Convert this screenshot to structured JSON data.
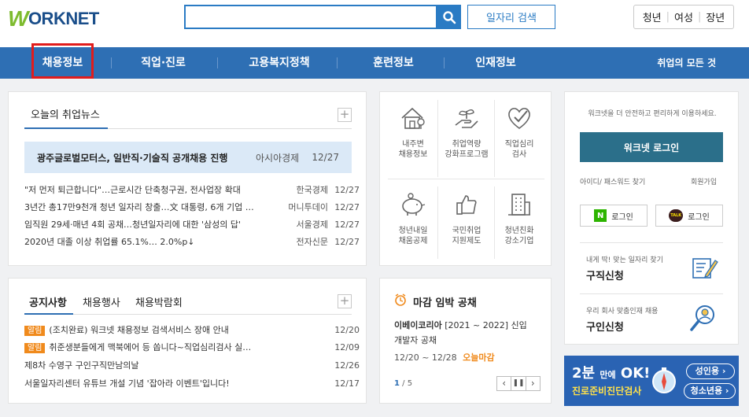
{
  "header": {
    "logo_w": "W",
    "logo_rest": "ORKNET",
    "search": {
      "value": "",
      "placeholder": ""
    },
    "job_search_label": "일자리 검색",
    "target_groups": [
      "청년",
      "여성",
      "장년"
    ]
  },
  "nav": {
    "items": [
      "채용정보",
      "직업·진로",
      "고용복지정책",
      "훈련정보",
      "인재정보"
    ],
    "right_label": "취업의 모든 것"
  },
  "news": {
    "tab_title": "오늘의 취업뉴스",
    "featured": {
      "title": "광주글로벌모터스, 일반직·기술직 공개채용 진행",
      "source": "아시아경제",
      "date": "12/27"
    },
    "items": [
      {
        "title": "\"저 먼저 퇴근합니다\"…근로시간 단축청구권, 전사업장 확대",
        "source": "한국경제",
        "date": "12/27"
      },
      {
        "title": "3년간 총17만9천개 청년 일자리 창출…文 대통령, 6개 기업 …",
        "source": "머니투데이",
        "date": "12/27"
      },
      {
        "title": "임직원 29세·매년 4회 공채…청년일자리에 대한 '삼성의 답'",
        "source": "서울경제",
        "date": "12/27"
      },
      {
        "title": "2020년 대졸 이상 취업률 65.1%… 2.0%p↓",
        "source": "전자신문",
        "date": "12/27"
      }
    ]
  },
  "quick": {
    "items": [
      {
        "line1": "내주변",
        "line2": "채용정보",
        "icon": "house-pin-icon"
      },
      {
        "line1": "취업역량",
        "line2": "강화프로그램",
        "icon": "hand-sprout-icon"
      },
      {
        "line1": "직업심리",
        "line2": "검사",
        "icon": "heart-check-icon"
      },
      {
        "line1": "청년내일",
        "line2": "채움공제",
        "icon": "piggy-bank-icon"
      },
      {
        "line1": "국민취업",
        "line2": "지원제도",
        "icon": "thumbs-up-icon"
      },
      {
        "line1": "청년친화",
        "line2": "강소기업",
        "icon": "building-icon"
      }
    ]
  },
  "login": {
    "notice": "워크넷을 더 안전하고 편리하게 이용하세요.",
    "login_button": "워크넷 로그인",
    "find_label": "아이디/ 패스워드 찾기",
    "signup_label": "회원가입",
    "naver_label": "로그인",
    "kakao_label": "로그인",
    "naver_icon_text": "N",
    "kakao_icon_text": "TALK"
  },
  "services": [
    {
      "sub": "내게 딱! 맞는 일자리 찾기",
      "title": "구직신청",
      "icon": "pen-paper-icon"
    },
    {
      "sub": "우리 회사 맞춤인재 채용",
      "title": "구인신청",
      "icon": "magnifier-person-icon"
    }
  ],
  "notice": {
    "tabs": [
      "공지사항",
      "채용행사",
      "채용박람회"
    ],
    "items": [
      {
        "badge": "알림",
        "title": "(조치완료) 워크넷 채용정보 검색서비스 장애 안내",
        "date": "12/20"
      },
      {
        "badge": "알림",
        "title": "취준생분들에게 맥북에어 등 쏩니다~직업심리검사 실…",
        "date": "12/09"
      },
      {
        "badge": "",
        "title": "제8차 수영구 구인구직만남의날",
        "date": "12/26"
      },
      {
        "badge": "",
        "title": "서울일자리센터 유튜브 개설 기념 '잡아라 이벤트'입니다!",
        "date": "12/17"
      }
    ]
  },
  "deadline": {
    "title": "마감 임박 공채",
    "company": "이베이코리아",
    "desc_line1": "[2021 ~ 2022] 신입",
    "desc_line2": "개발자 공채",
    "period": "12/20 ~ 12/28",
    "status": "오늘마감",
    "page_current": "1",
    "page_total": "/ 5"
  },
  "banner": {
    "line1_big": "2분",
    "line1_small": "만에",
    "line1_end": "OK!",
    "line2": "진로준비진단검사",
    "btn_adult": "성인용 ›",
    "btn_youth": "청소년용 ›"
  },
  "colors": {
    "primary": "#2e6fb4",
    "accent": "#2a7bc4",
    "teal": "#2b6f8a",
    "orange": "#f08a1c"
  }
}
